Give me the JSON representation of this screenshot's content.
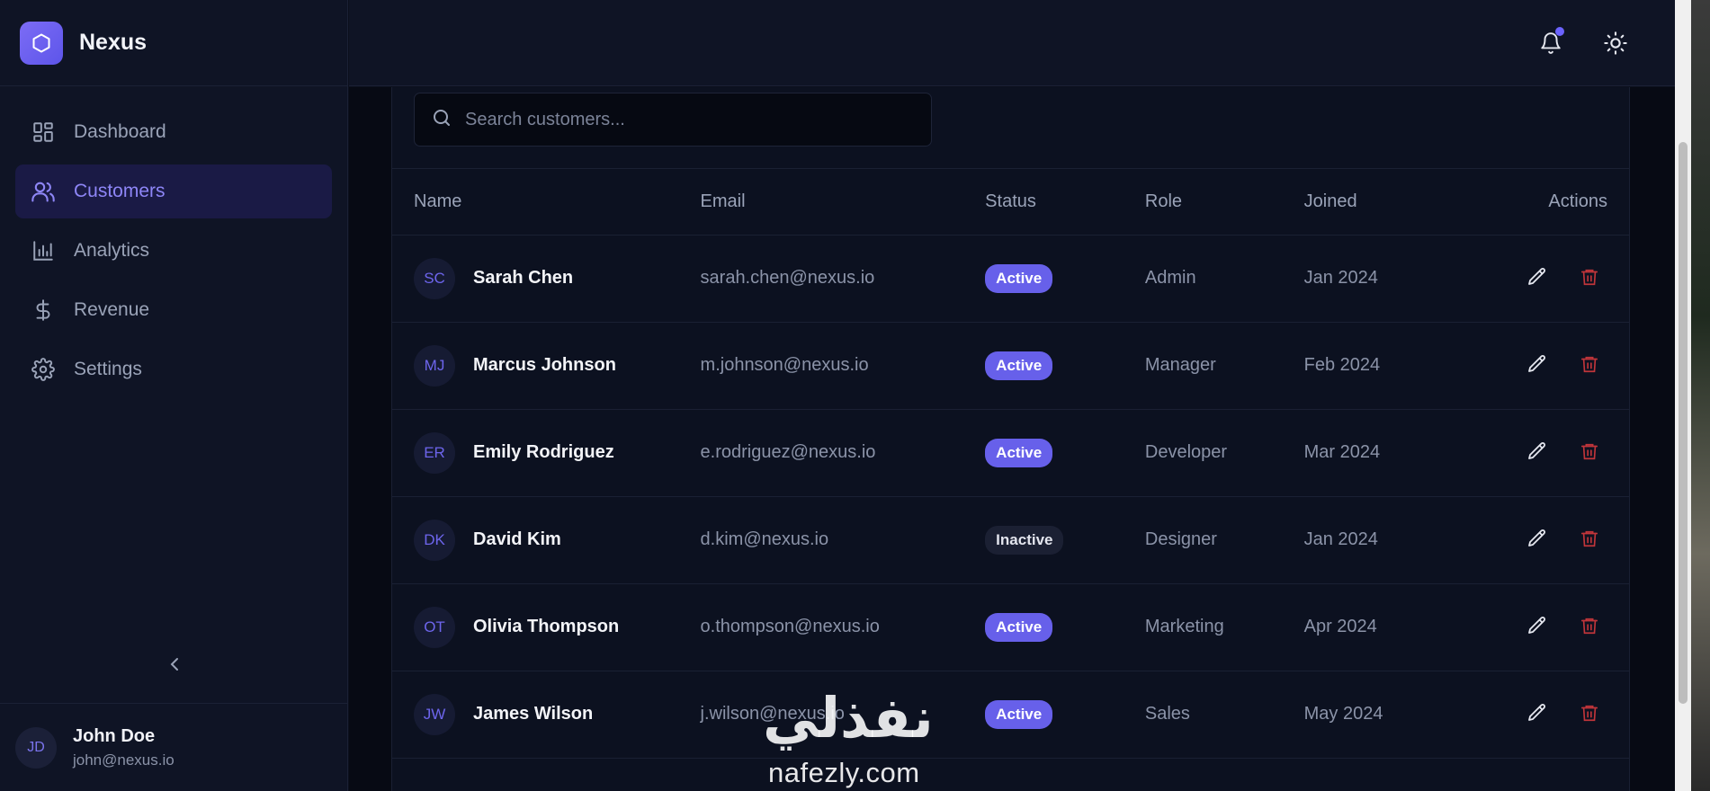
{
  "app": {
    "name": "Nexus"
  },
  "sidebar": {
    "items": [
      {
        "label": "Dashboard",
        "icon": "dashboard-icon",
        "active": false
      },
      {
        "label": "Customers",
        "icon": "users-icon",
        "active": true
      },
      {
        "label": "Analytics",
        "icon": "bar-chart-icon",
        "active": false
      },
      {
        "label": "Revenue",
        "icon": "dollar-icon",
        "active": false
      },
      {
        "label": "Settings",
        "icon": "gear-icon",
        "active": false
      }
    ],
    "user": {
      "initials": "JD",
      "name": "John Doe",
      "email": "john@nexus.io"
    }
  },
  "topbar": {
    "notification_dot": true
  },
  "search": {
    "placeholder": "Search customers...",
    "value": ""
  },
  "table": {
    "headers": {
      "name": "Name",
      "email": "Email",
      "status": "Status",
      "role": "Role",
      "joined": "Joined",
      "actions": "Actions"
    },
    "rows": [
      {
        "initials": "SC",
        "name": "Sarah Chen",
        "email": "sarah.chen@nexus.io",
        "status": "Active",
        "role": "Admin",
        "joined": "Jan 2024"
      },
      {
        "initials": "MJ",
        "name": "Marcus Johnson",
        "email": "m.johnson@nexus.io",
        "status": "Active",
        "role": "Manager",
        "joined": "Feb 2024"
      },
      {
        "initials": "ER",
        "name": "Emily Rodriguez",
        "email": "e.rodriguez@nexus.io",
        "status": "Active",
        "role": "Developer",
        "joined": "Mar 2024"
      },
      {
        "initials": "DK",
        "name": "David Kim",
        "email": "d.kim@nexus.io",
        "status": "Inactive",
        "role": "Designer",
        "joined": "Jan 2024"
      },
      {
        "initials": "OT",
        "name": "Olivia Thompson",
        "email": "o.thompson@nexus.io",
        "status": "Active",
        "role": "Marketing",
        "joined": "Apr 2024"
      },
      {
        "initials": "JW",
        "name": "James Wilson",
        "email": "j.wilson@nexus.io",
        "status": "Active",
        "role": "Sales",
        "joined": "May 2024"
      }
    ]
  },
  "watermark": {
    "arabic": "نفذلي",
    "latin": "nafezly.com"
  },
  "colors": {
    "accent": "#6760ea",
    "danger": "#c0353a",
    "background": "#0b0f1c"
  }
}
